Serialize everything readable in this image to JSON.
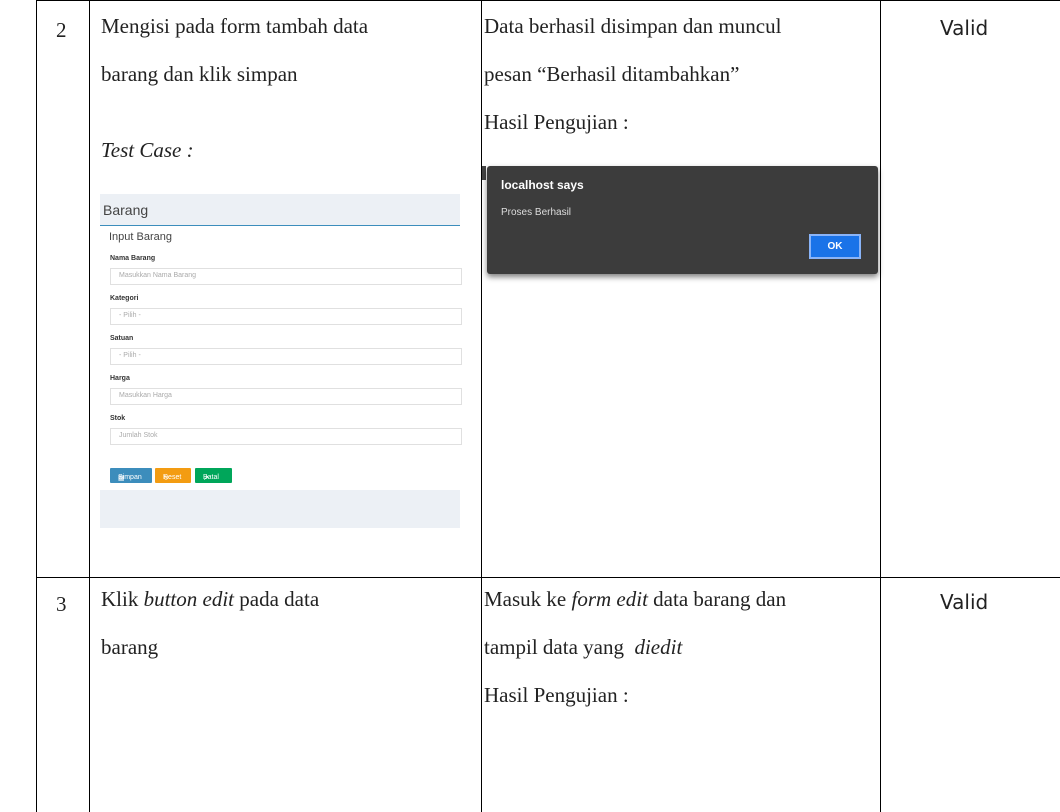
{
  "rows": [
    {
      "no": "2",
      "scenario_l1": "Mengisi pada form tambah data",
      "scenario_l2": "barang dan klik simpan",
      "test_case_label": "Test Case :",
      "expected_l1": "Data berhasil disimpan dan muncul",
      "expected_l2": "pesan “Berhasil ditambahkan”",
      "result_label": "Hasil Pengujian :",
      "conclusion": "Valid"
    },
    {
      "no": "3",
      "scenario_l1_pre": "Klik ",
      "scenario_l1_em": "button edit",
      "scenario_l1_post": " pada data",
      "scenario_l2": "barang",
      "expected_l1_pre": "Masuk ke ",
      "expected_l1_em": "form edit",
      "expected_l1_post": " data barang dan",
      "expected_l2_pre": "tampil data yang  ",
      "expected_l2_em": "diedit",
      "result_label": "Hasil Pengujian :",
      "conclusion": "Valid"
    }
  ],
  "form_screenshot": {
    "page_title": "Barang",
    "panel_title": "Input Barang",
    "fields": [
      {
        "label": "Nama Barang",
        "placeholder": "Masukkan Nama Barang"
      },
      {
        "label": "Kategori",
        "placeholder": "- Pilih -"
      },
      {
        "label": "Satuan",
        "placeholder": "- Pilih -"
      },
      {
        "label": "Harga",
        "placeholder": "Masukkan Harga"
      },
      {
        "label": "Stok",
        "placeholder": "Jumlah Stok"
      }
    ],
    "buttons": {
      "save": "Simpan",
      "reset": "Reset",
      "cancel": "Batal"
    },
    "colors": {
      "save": "#3c8dbc",
      "reset": "#f39c12",
      "cancel": "#00a65a"
    }
  },
  "dialog_screenshot": {
    "title": "localhost says",
    "message": "Proses Berhasil",
    "ok_label": "OK"
  }
}
